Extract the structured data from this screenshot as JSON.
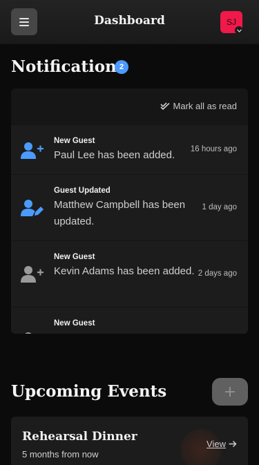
{
  "header": {
    "title": "Dashboard",
    "avatar_initials": "SJ",
    "menu_icon": "hamburger-icon",
    "caret_icon": "chevron-down-icon",
    "avatar_color": "#f0194a"
  },
  "notifications": {
    "heading": "Notifications",
    "unread_count": "2",
    "badge_color": "#4b9bff",
    "mark_all_label": "Mark all as read",
    "items": [
      {
        "type": "New Guest",
        "message": "Paul Lee has been added.",
        "time": "16 hours ago",
        "icon": "user-plus-icon",
        "icon_color": "#4b9bff",
        "unread": true
      },
      {
        "type": "Guest Updated",
        "message": "Matthew Campbell has been updated.",
        "time": "1 day ago",
        "icon": "user-edit-icon",
        "icon_color": "#4b9bff",
        "unread": true
      },
      {
        "type": "New Guest",
        "message": "Kevin Adams has been added.",
        "time": "2 days ago",
        "icon": "user-plus-icon",
        "icon_color": "#9a9a9a",
        "unread": false
      },
      {
        "type": "New Guest",
        "message": "",
        "time": "",
        "icon": "user-plus-icon",
        "icon_color": "#9a9a9a",
        "unread": false
      }
    ]
  },
  "events": {
    "heading": "Upcoming Events",
    "add_icon": "plus-icon",
    "items": [
      {
        "name": "Rehearsal Dinner",
        "when": "5 months from now",
        "view_label": "View"
      }
    ]
  }
}
